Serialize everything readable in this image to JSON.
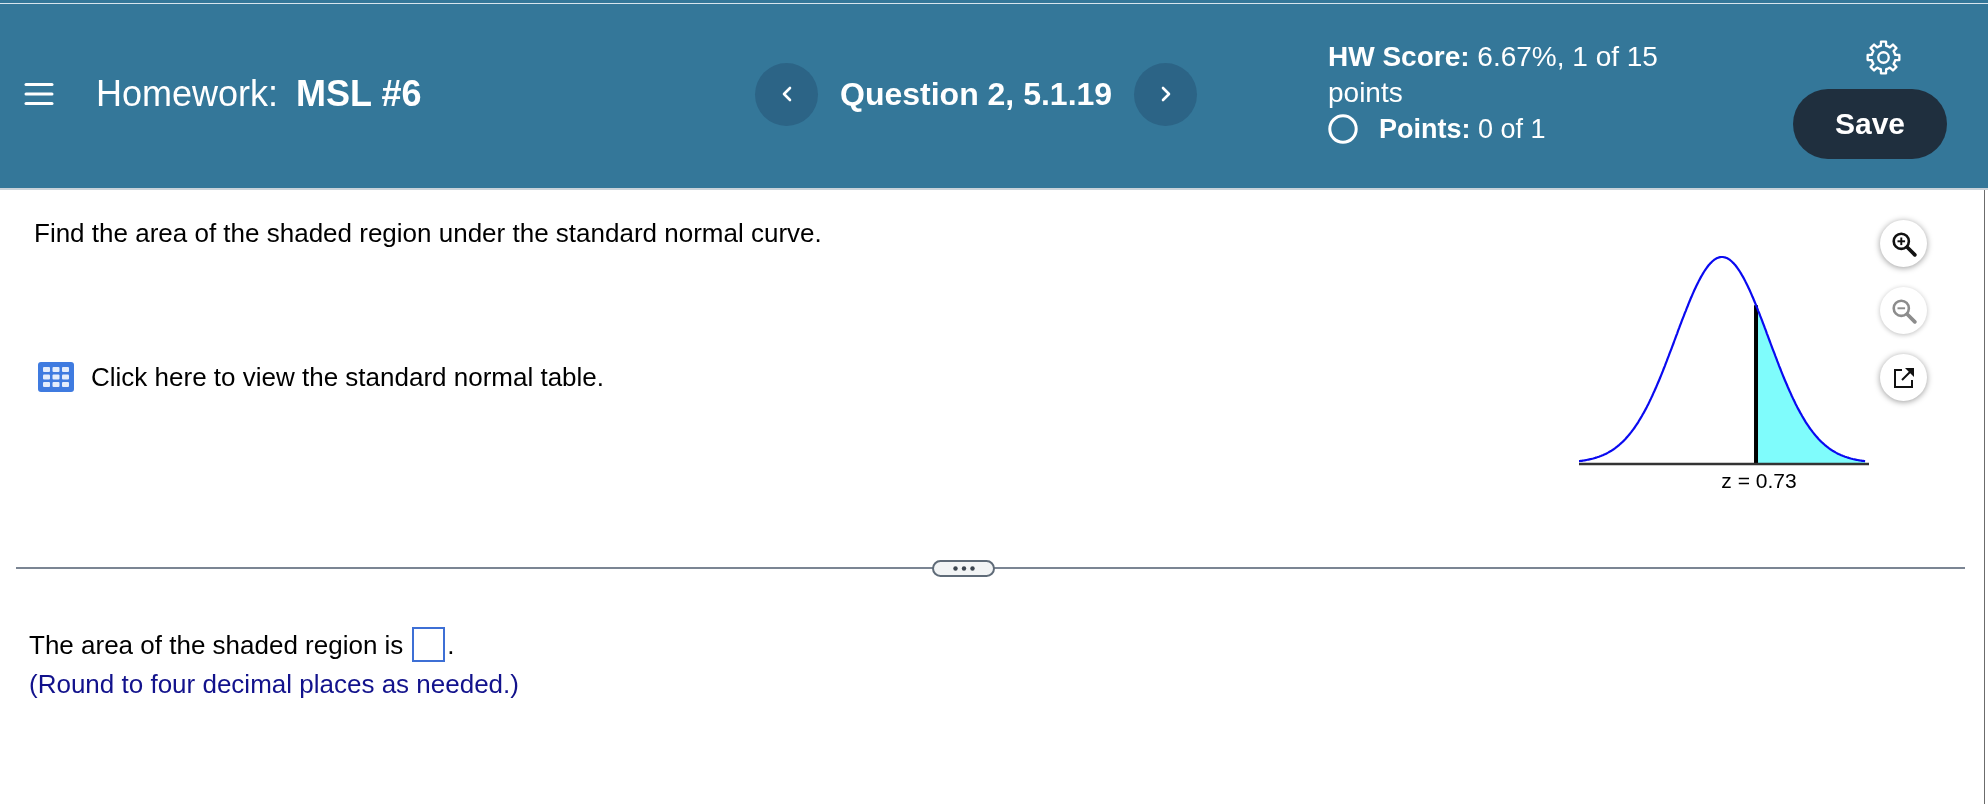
{
  "header": {
    "title_label": "Homework:",
    "title": "MSL #6",
    "question": "Question 2, 5.1.19",
    "hw_score": "**HW Score:** 6.67%, 1 of 15 points",
    "points": "**Points:** 0 of 1",
    "save_label": "Save"
  },
  "question": {
    "prompt": "Find the area of the shaded region under the standard normal curve.",
    "table_link": "Click here to view the standard normal table."
  },
  "figure": {
    "kind": "right-tail",
    "z_label": "z = 0.73"
  },
  "figure_tools": [
    {
      "kind": "zoom-in",
      "disabled": false
    },
    {
      "kind": "zoom-out",
      "disabled": true
    },
    {
      "kind": "pop-out",
      "disabled": false
    }
  ],
  "answer": {
    "prompt": "The area of the shaded region is",
    "suffix": ".",
    "hint": "(Round to four decimal places as needed.)"
  }
}
